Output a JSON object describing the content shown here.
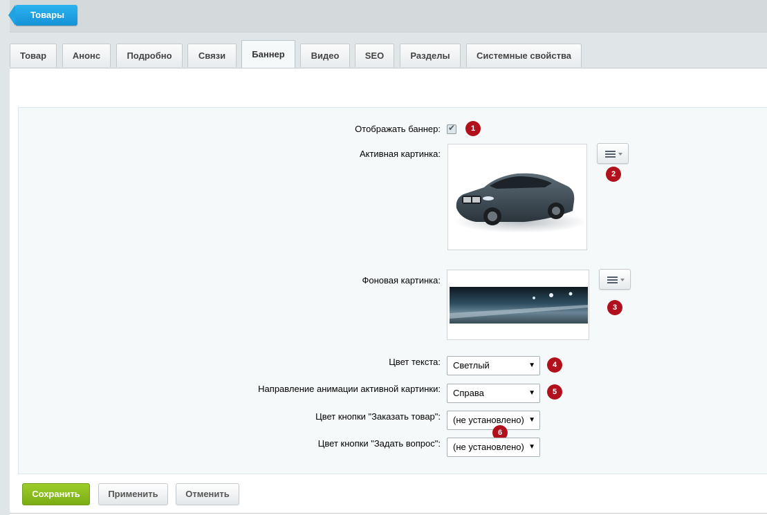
{
  "header": {
    "back_label": "Товары"
  },
  "tabs": [
    {
      "label": "Товар"
    },
    {
      "label": "Анонс"
    },
    {
      "label": "Подробно"
    },
    {
      "label": "Связи"
    },
    {
      "label": "Баннер",
      "active": true
    },
    {
      "label": "Видео"
    },
    {
      "label": "SEO"
    },
    {
      "label": "Разделы"
    },
    {
      "label": "Системные свойства"
    }
  ],
  "form": {
    "show_banner": {
      "label": "Отображать баннер:",
      "checked": true
    },
    "active_image": {
      "label": "Активная картинка:"
    },
    "background_image": {
      "label": "Фоновая картинка:"
    },
    "text_color": {
      "label": "Цвет текста:",
      "value": "Светлый"
    },
    "animation_direction": {
      "label": "Направление анимации активной картинки:",
      "value": "Справа"
    },
    "order_button_color": {
      "label": "Цвет кнопки \"Заказать товар\":",
      "value": "(не установлено)"
    },
    "ask_button_color": {
      "label": "Цвет кнопки \"Задать вопрос\":",
      "value": "(не установлено)"
    }
  },
  "badges": [
    "1",
    "2",
    "3",
    "4",
    "5",
    "6"
  ],
  "buttons": {
    "save": "Сохранить",
    "apply": "Применить",
    "cancel": "Отменить"
  },
  "colors": {
    "accent_blue": "#1a9de0",
    "save_green": "#86b91c",
    "badge_red": "#b0111c"
  }
}
